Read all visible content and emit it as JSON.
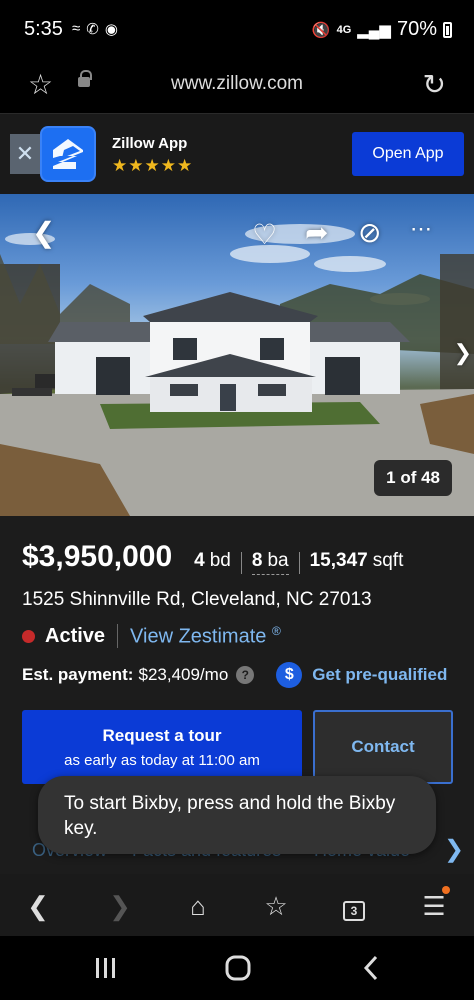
{
  "status_bar": {
    "time": "5:35",
    "battery": "70%",
    "icons": [
      "wifi-icon",
      "missed-call-icon",
      "bixby-routine-icon",
      "mute-icon",
      "4g-lte-icon",
      "signal-icon",
      "battery-icon"
    ]
  },
  "browser": {
    "url": "www.zillow.com"
  },
  "app_banner": {
    "name": "Zillow App",
    "stars": "★★★★★",
    "open_label": "Open App"
  },
  "photo": {
    "counter": "1 of 48"
  },
  "listing": {
    "price": "$3,950,000",
    "beds_value": "4",
    "beds_unit": "bd",
    "baths_value": "8",
    "baths_unit": "ba",
    "sqft_value": "15,347",
    "sqft_unit": "sqft",
    "address": "1525 Shinnville Rd, Cleveland, NC 27013",
    "status": "Active",
    "status_color": "#c62a2a",
    "zestimate_link": "View Zestimate",
    "zestimate_mark": "®",
    "payment_label": "Est. payment:",
    "payment_value": "$23,409/mo",
    "prequal_link": "Get pre-qualified"
  },
  "actions": {
    "tour_title": "Request a tour",
    "tour_subtitle": "as early as today at 11:00 am",
    "contact_label": "Contact"
  },
  "section_tabs": [
    "Overview",
    "Facts and features",
    "Home value"
  ],
  "toast": {
    "message": "To start Bixby, press and hold the Bixby key."
  },
  "toolbar": {
    "tabs_count": "3"
  },
  "colors": {
    "accent_blue": "#0b3bd6",
    "link_blue": "#7fb8f0",
    "star_gold": "#f0b81e"
  }
}
